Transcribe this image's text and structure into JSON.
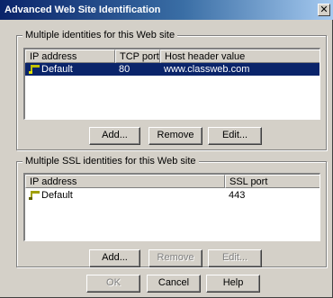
{
  "window": {
    "title": "Advanced Web Site Identification",
    "close_glyph": "✕"
  },
  "identities": {
    "group_label": "Multiple identities for this Web site",
    "columns": [
      "IP address",
      "TCP port",
      "Host header value"
    ],
    "rows": [
      {
        "ip": "Default",
        "port": "80",
        "host": "www.classweb.com",
        "selected": true
      }
    ],
    "buttons": {
      "add": "Add...",
      "remove": "Remove",
      "edit": "Edit..."
    }
  },
  "ssl_identities": {
    "group_label": "Multiple SSL identities for this Web site",
    "columns": [
      "IP address",
      "SSL port"
    ],
    "rows": [
      {
        "ip": "Default",
        "port": "443",
        "selected": false
      }
    ],
    "buttons": {
      "add": "Add...",
      "remove": "Remove",
      "edit": "Edit..."
    }
  },
  "footer": {
    "ok": "OK",
    "cancel": "Cancel",
    "help": "Help"
  },
  "colors": {
    "selection": "#0a246a",
    "face": "#d4d0c8",
    "title_start": "#0a246a",
    "title_end": "#a6caf0"
  }
}
